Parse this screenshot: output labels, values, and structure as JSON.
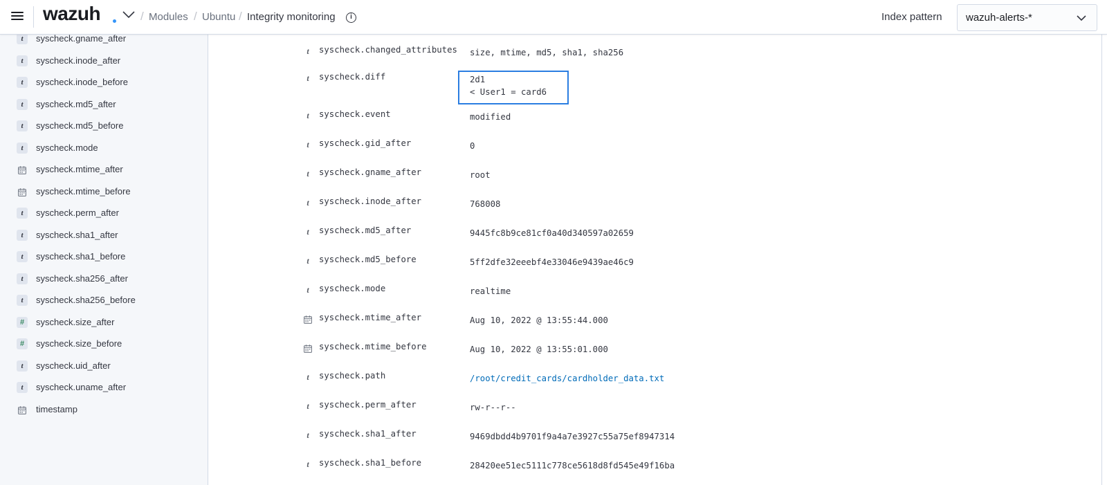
{
  "header": {
    "logo": "wazuh",
    "breadcrumb": [
      "Modules",
      "Ubuntu"
    ],
    "current_page": "Integrity monitoring",
    "index_pattern_label": "Index pattern",
    "index_pattern_value": "wazuh-alerts-*"
  },
  "sidebar": {
    "items": [
      {
        "type": "t",
        "label": "syscheck.gname_after"
      },
      {
        "type": "t",
        "label": "syscheck.inode_after"
      },
      {
        "type": "t",
        "label": "syscheck.inode_before"
      },
      {
        "type": "t",
        "label": "syscheck.md5_after"
      },
      {
        "type": "t",
        "label": "syscheck.md5_before"
      },
      {
        "type": "t",
        "label": "syscheck.mode"
      },
      {
        "type": "date",
        "label": "syscheck.mtime_after"
      },
      {
        "type": "date",
        "label": "syscheck.mtime_before"
      },
      {
        "type": "t",
        "label": "syscheck.perm_after"
      },
      {
        "type": "t",
        "label": "syscheck.sha1_after"
      },
      {
        "type": "t",
        "label": "syscheck.sha1_before"
      },
      {
        "type": "t",
        "label": "syscheck.sha256_after"
      },
      {
        "type": "t",
        "label": "syscheck.sha256_before"
      },
      {
        "type": "#",
        "label": "syscheck.size_after"
      },
      {
        "type": "#",
        "label": "syscheck.size_before"
      },
      {
        "type": "t",
        "label": "syscheck.uid_after"
      },
      {
        "type": "t",
        "label": "syscheck.uname_after"
      },
      {
        "type": "date",
        "label": "timestamp"
      }
    ]
  },
  "document": {
    "fields": [
      {
        "type": "t",
        "name": "syscheck.changed_attributes",
        "value": "size, mtime, md5, sha1, sha256"
      },
      {
        "type": "t",
        "name": "syscheck.diff",
        "value": "2d1\n< User1 = card6"
      },
      {
        "type": "t",
        "name": "syscheck.event",
        "value": "modified"
      },
      {
        "type": "t",
        "name": "syscheck.gid_after",
        "value": "0"
      },
      {
        "type": "t",
        "name": "syscheck.gname_after",
        "value": "root"
      },
      {
        "type": "t",
        "name": "syscheck.inode_after",
        "value": "768008"
      },
      {
        "type": "t",
        "name": "syscheck.md5_after",
        "value": "9445fc8b9ce81cf0a40d340597a02659"
      },
      {
        "type": "t",
        "name": "syscheck.md5_before",
        "value": "5ff2dfe32eeebf4e33046e9439ae46c9"
      },
      {
        "type": "t",
        "name": "syscheck.mode",
        "value": "realtime"
      },
      {
        "type": "date",
        "name": "syscheck.mtime_after",
        "value": "Aug 10, 2022 @ 13:55:44.000"
      },
      {
        "type": "date",
        "name": "syscheck.mtime_before",
        "value": "Aug 10, 2022 @ 13:55:01.000"
      },
      {
        "type": "t",
        "name": "syscheck.path",
        "value": "/root/credit_cards/cardholder_data.txt",
        "link": true
      },
      {
        "type": "t",
        "name": "syscheck.perm_after",
        "value": "rw-r--r--"
      },
      {
        "type": "t",
        "name": "syscheck.sha1_after",
        "value": "9469dbdd4b9701f9a4a7e3927c55a75ef8947314"
      },
      {
        "type": "t",
        "name": "syscheck.sha1_before",
        "value": "28420ee51ec5111c778ce5618d8fd545e49f16ba"
      }
    ]
  }
}
